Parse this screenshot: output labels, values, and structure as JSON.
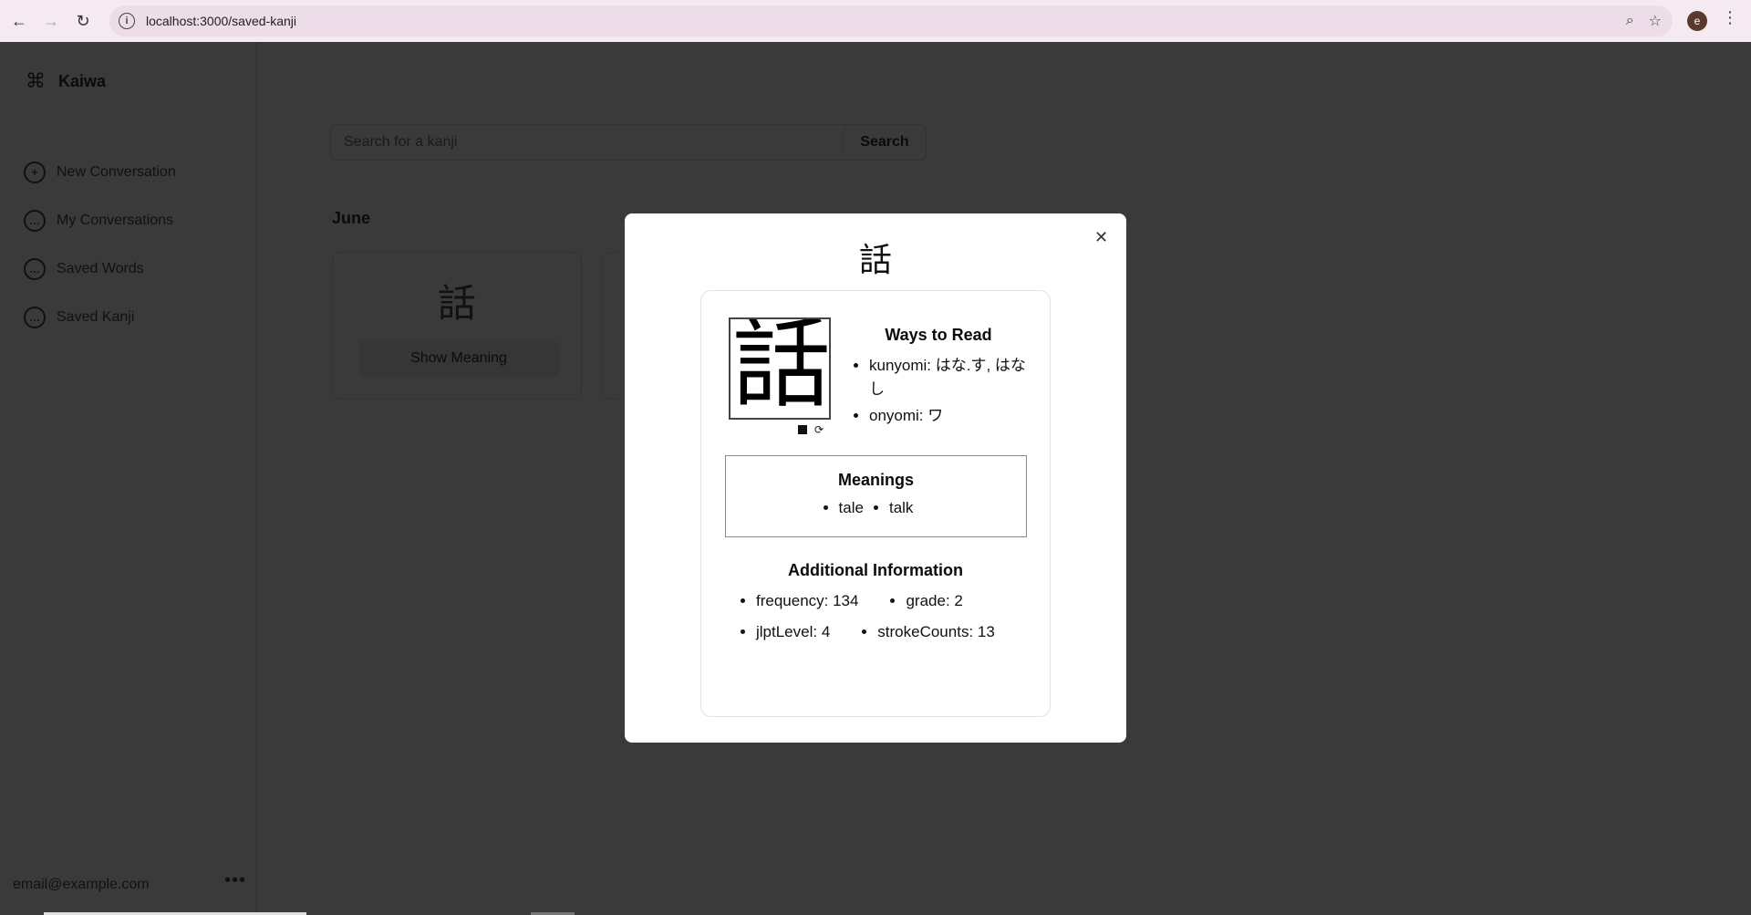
{
  "browser": {
    "url": "localhost:3000/saved-kanji",
    "profile_initial": "e"
  },
  "sidebar": {
    "brand": "Kaiwa",
    "items": [
      {
        "label": "New Conversation"
      },
      {
        "label": "My Conversations"
      },
      {
        "label": "Saved Words"
      },
      {
        "label": "Saved Kanji"
      }
    ],
    "email": "email@example.com"
  },
  "main": {
    "search": {
      "placeholder": "Search for a kanji",
      "button": "Search"
    },
    "month": "June",
    "card": {
      "kanji": "話",
      "button": "Show Meaning"
    }
  },
  "modal": {
    "kanji": "話",
    "ways_title": "Ways to Read",
    "kunyomi": "kunyomi: はな.す, はなし",
    "onyomi": "onyomi: ワ",
    "meanings_title": "Meanings",
    "meanings": [
      "tale",
      "talk"
    ],
    "additional_title": "Additional Information",
    "frequency": "frequency: 134",
    "grade": "grade: 2",
    "jlpt": "jlptLevel: 4",
    "strokes": "strokeCounts: 13"
  }
}
